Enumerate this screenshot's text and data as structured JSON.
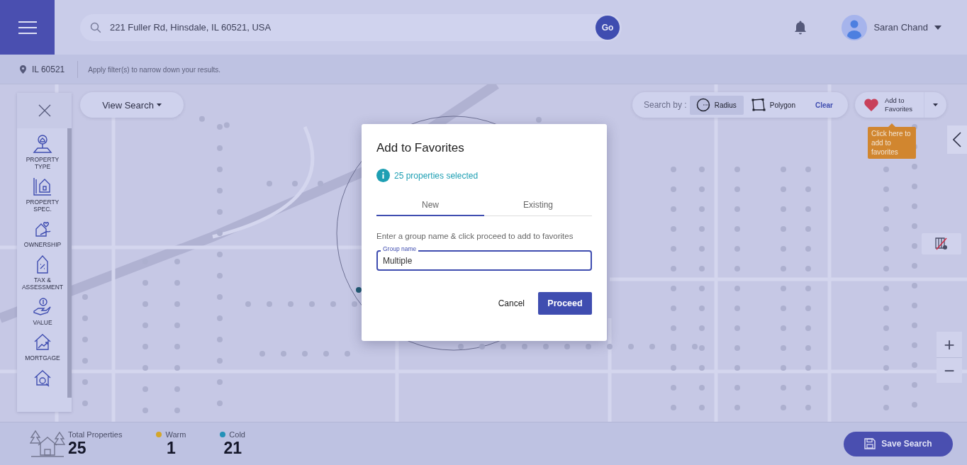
{
  "header": {
    "search": {
      "value": "221 Fuller Rd, Hinsdale, IL 60521, USA"
    },
    "go_button": "Go",
    "user": {
      "name": "Saran Chand"
    }
  },
  "filter_bar": {
    "location": "IL 60521",
    "hint": "Apply filter(s) to narrow down your results."
  },
  "sidebar": {
    "items": [
      {
        "label": "PROPERTY TYPE",
        "kind": "pin"
      },
      {
        "label": "PROPERTY SPEC.",
        "kind": "spec"
      },
      {
        "label": "OWNERSHIP",
        "kind": "ownership"
      },
      {
        "label": "TAX & ASSESSMENT",
        "kind": "tax"
      },
      {
        "label": "VALUE",
        "kind": "value"
      },
      {
        "label": "MORTGAGE",
        "kind": "mortgage"
      },
      {
        "kind": "heart-home"
      }
    ]
  },
  "view_search": "View Search",
  "search_by": {
    "label": "Search by :",
    "options": [
      {
        "label": "Radius",
        "kind": "radius",
        "selected": true
      },
      {
        "label": "Polygon",
        "kind": "polygon",
        "selected": false
      }
    ],
    "clear": "Clear"
  },
  "favorites_button": "Add to Favorites",
  "tooltip": "Click here to add to favorites",
  "zoom_controls": [
    "+",
    "−"
  ],
  "modal": {
    "title": "Add to Favorites",
    "info": "25 properties selected",
    "tabs": [
      {
        "label": "New",
        "selected": true
      },
      {
        "label": "Existing",
        "selected": false
      }
    ],
    "instruction": "Enter a group name & click proceed to add to favorites",
    "field": {
      "label": "Group name",
      "value": "Multiple"
    },
    "cancel": "Cancel",
    "proceed": "Proceed"
  },
  "stats": [
    {
      "label": "Total Properties",
      "value": "25",
      "kind": "total"
    },
    {
      "label": "Warm",
      "value": "1",
      "kind": "dot",
      "color": "#d4a62a"
    },
    {
      "label": "Cold",
      "value": "21",
      "kind": "dot",
      "color": "#2391b8"
    }
  ],
  "save_search": "Save Search"
}
